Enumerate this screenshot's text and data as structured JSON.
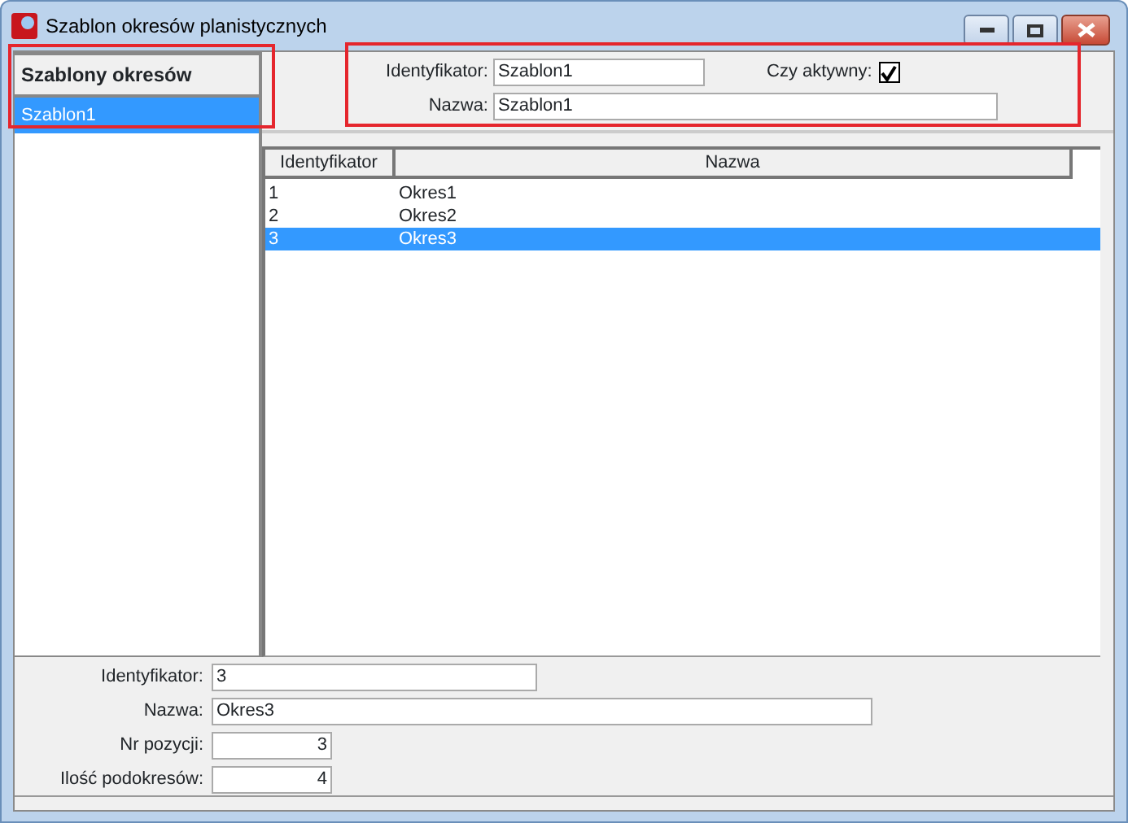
{
  "window": {
    "title": "Szablon okresów planistycznych"
  },
  "sidebar": {
    "title": "Szablony okresów",
    "items": [
      {
        "label": "Szablon1",
        "selected": true
      }
    ]
  },
  "template_form": {
    "id_label": "Identyfikator:",
    "id_value": "Szablon1",
    "active_label": "Czy aktywny:",
    "active": true,
    "name_label": "Nazwa:",
    "name_value": "Szablon1"
  },
  "table": {
    "columns": [
      "Identyfikator",
      "Nazwa"
    ],
    "rows": [
      {
        "cells": [
          "1",
          "Okres1"
        ],
        "selected": false
      },
      {
        "cells": [
          "2",
          "Okres2"
        ],
        "selected": false
      },
      {
        "cells": [
          "3",
          "Okres3"
        ],
        "selected": true
      }
    ]
  },
  "detail_form": {
    "fields": [
      {
        "label": "Identyfikator:",
        "value": "3",
        "kind": "wide"
      },
      {
        "label": "Nazwa:",
        "value": "Okres3",
        "kind": "wider"
      },
      {
        "label": "Nr pozycji:",
        "value": "3",
        "kind": "short"
      },
      {
        "label": "Ilość podokresów:",
        "value": "4",
        "kind": "short"
      }
    ]
  }
}
